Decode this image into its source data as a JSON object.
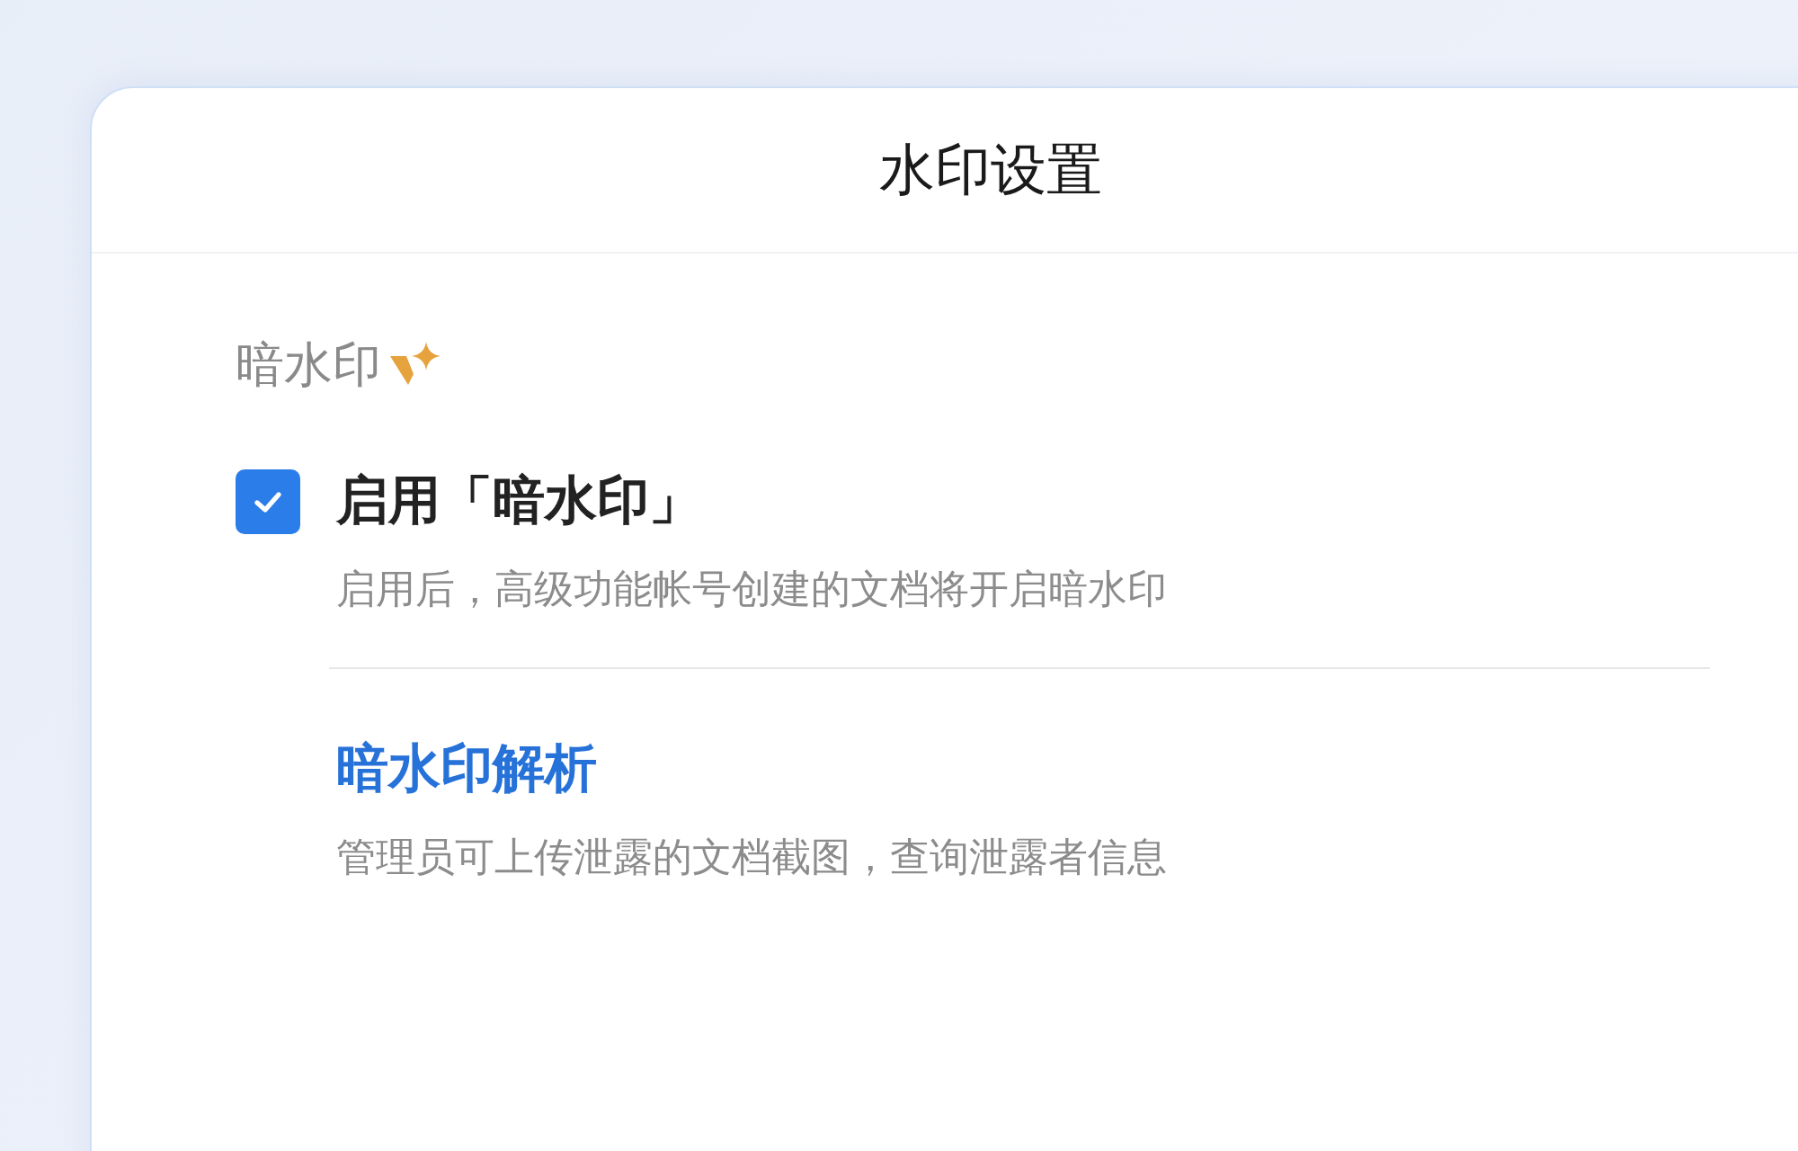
{
  "dialog": {
    "title": "水印设置"
  },
  "section": {
    "label": "暗水印"
  },
  "option": {
    "label": "启用「暗水印」",
    "checked": true,
    "description": "启用后，高级功能帐号创建的文档将开启暗水印"
  },
  "analysis": {
    "link": "暗水印解析",
    "description": "管理员可上传泄露的文档截图，查询泄露者信息"
  }
}
